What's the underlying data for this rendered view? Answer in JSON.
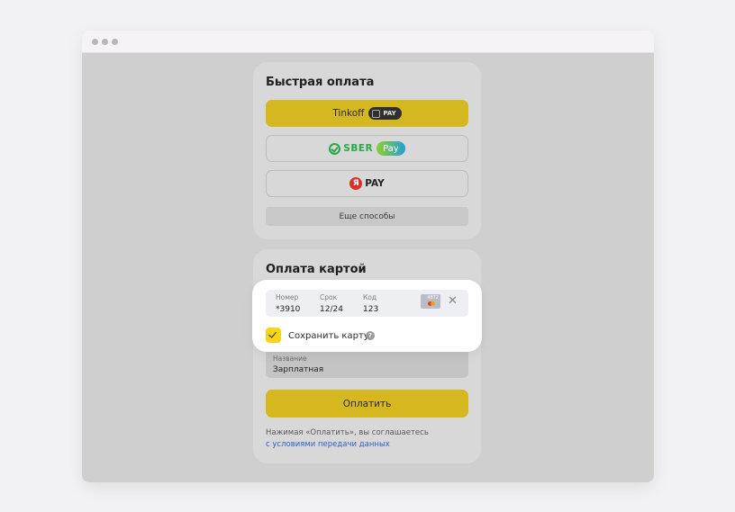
{
  "quick_pay": {
    "title": "Быстрая оплата",
    "tinkoff_label": "Tinkoff",
    "tinkoff_badge": "PAY",
    "sber_label": "SBER",
    "sber_badge": "Pay",
    "yandex_icon_letter": "Я",
    "yandex_label": "PAY",
    "more_label": "Еще способы"
  },
  "card_pay": {
    "title": "Оплата картой",
    "saved_card": {
      "number_label": "Номер",
      "number_value": "*3910",
      "expiry_label": "Срок",
      "expiry_value": "12/24",
      "cvc_label": "Код",
      "cvc_value": "123",
      "brand_number": "4872",
      "brand_icon": "mastercard-icon",
      "remove_icon": "close-icon"
    },
    "save_card_label": "Сохранить карту",
    "save_card_checked": true,
    "help_symbol": "?",
    "name_label": "Название",
    "name_value": "Зарплатная",
    "pay_button_label": "Оплатить",
    "terms_text": "Нажимая «Оплатить», вы соглашаетесь",
    "terms_link": "с условиями передачи данных"
  },
  "colors": {
    "accent_yellow": "#d5b720",
    "checkbox_yellow": "#f5d514",
    "sber_green": "#27a84a",
    "yandex_red": "#d9322b",
    "link_blue": "#2f5fc4"
  }
}
